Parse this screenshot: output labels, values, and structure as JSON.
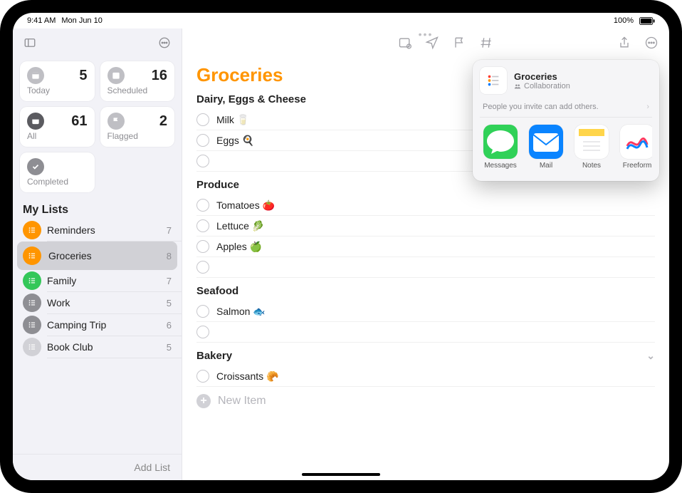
{
  "statusbar": {
    "time": "9:41 AM",
    "date": "Mon Jun 10",
    "battery": "100%"
  },
  "sidebar": {
    "smart": {
      "today": {
        "label": "Today",
        "count": "5"
      },
      "scheduled": {
        "label": "Scheduled",
        "count": "16"
      },
      "all": {
        "label": "All",
        "count": "61"
      },
      "flagged": {
        "label": "Flagged",
        "count": "2"
      },
      "completed": {
        "label": "Completed",
        "count": ""
      }
    },
    "mylists_header": "My Lists",
    "lists": [
      {
        "name": "Reminders",
        "count": "7",
        "color": "#ff9500"
      },
      {
        "name": "Groceries",
        "count": "8",
        "color": "#ff9500",
        "selected": true
      },
      {
        "name": "Family",
        "count": "7",
        "color": "#34c759"
      },
      {
        "name": "Work",
        "count": "5",
        "color": "#8e8e93"
      },
      {
        "name": "Camping Trip",
        "count": "6",
        "color": "#8e8e93"
      },
      {
        "name": "Book Club",
        "count": "5",
        "color": "#d1d1d6"
      }
    ],
    "add_list": "Add List"
  },
  "main": {
    "title": "Groceries",
    "new_item": "New Item",
    "sections": [
      {
        "header": "Dairy, Eggs & Cheese",
        "items": [
          "Milk 🥛",
          "Eggs 🍳"
        ],
        "trailing_empty": true
      },
      {
        "header": "Produce",
        "items": [
          "Tomatoes 🍅",
          "Lettuce 🥬",
          "Apples 🍏"
        ],
        "trailing_empty": true
      },
      {
        "header": "Seafood",
        "items": [
          "Salmon 🐟"
        ],
        "trailing_empty": true
      },
      {
        "header": "Bakery",
        "items": [
          "Croissants 🥐"
        ],
        "collapsible": true
      }
    ]
  },
  "share": {
    "title": "Groceries",
    "subtitle": "Collaboration",
    "note": "People you invite can add others.",
    "apps": [
      {
        "label": "Messages",
        "bg": "#30d158"
      },
      {
        "label": "Mail",
        "bg": "#0a84ff"
      },
      {
        "label": "Notes",
        "bg": "#ffffff"
      },
      {
        "label": "Freeform",
        "bg": "#ffffff"
      }
    ]
  }
}
